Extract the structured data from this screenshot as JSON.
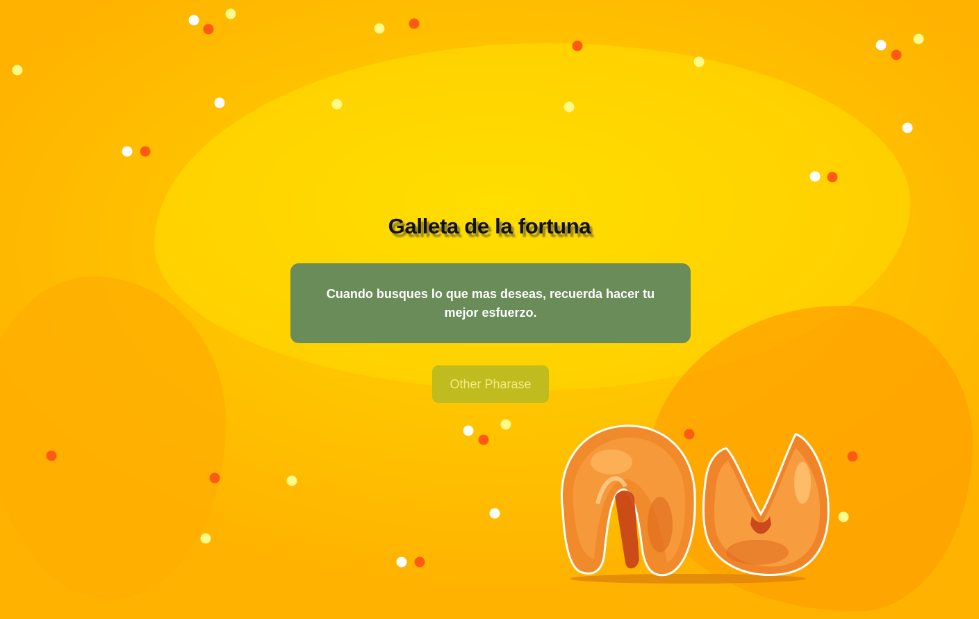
{
  "app": {
    "title": "Galleta de la fortuna"
  },
  "fortune": {
    "text": "Cuando busques lo que mas deseas, recuerda hacer tu mejor esfuerzo."
  },
  "actions": {
    "other_phrase_label": "Other Pharase"
  },
  "illustration": {
    "icon": "fortune-cookies-illustration"
  },
  "colors": {
    "background": "#ffc600",
    "card": "#6a8c59",
    "button": "#c0bb1e",
    "button_text": "#f1ec83",
    "confetti_orange": "#ff5a14",
    "confetti_cream": "#fffa8a",
    "confetti_white": "#ffffff"
  }
}
